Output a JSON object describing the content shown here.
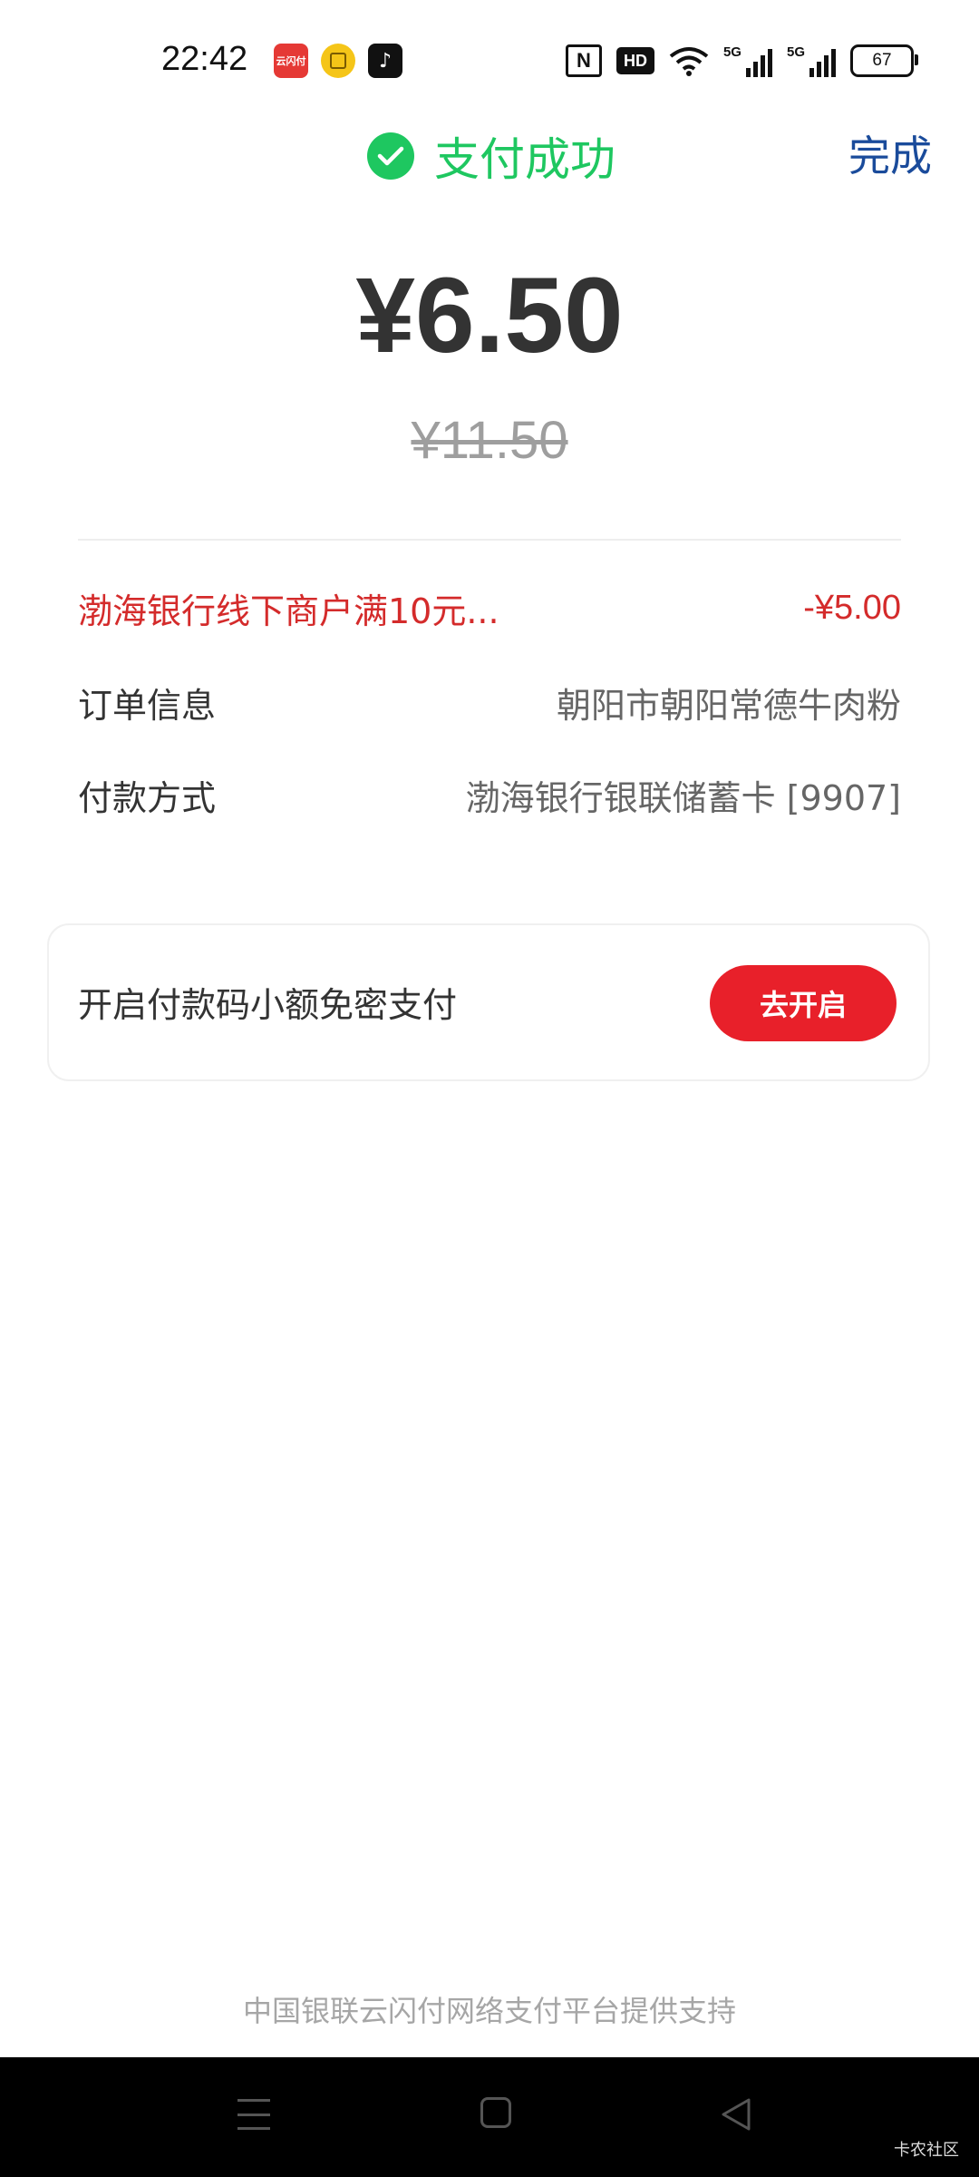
{
  "status_bar": {
    "time": "22:42",
    "battery": "67",
    "app_icons": [
      "cloud-quickpass-icon",
      "yellow-app-icon",
      "tiktok-icon"
    ],
    "network": [
      "nfc-icon",
      "hd-voice-icon",
      "wifi-icon",
      "5g-signal-icon",
      "5g-signal-icon",
      "battery-icon"
    ],
    "signal_label_1": "5G",
    "signal_label_2": "5G",
    "hd_label": "HD",
    "nfc_label": "N"
  },
  "header": {
    "status_text": "支付成功",
    "done_label": "完成",
    "accent_color": "#1ec760"
  },
  "amounts": {
    "paid": "¥6.50",
    "original": "¥11.50"
  },
  "details": {
    "discount": {
      "label": "渤海银行线下商户满10元...",
      "value": "-¥5.00"
    },
    "order": {
      "label": "订单信息",
      "value": "朝阳市朝阳常德牛肉粉"
    },
    "payment_method": {
      "label": "付款方式",
      "value": "渤海银行银联储蓄卡 [9907]"
    }
  },
  "promo": {
    "text": "开启付款码小额免密支付",
    "button_label": "去开启",
    "button_color": "#e8202a"
  },
  "footer": {
    "text": "中国银联云闪付网络支付平台提供支持"
  },
  "watermark": "卡农社区"
}
